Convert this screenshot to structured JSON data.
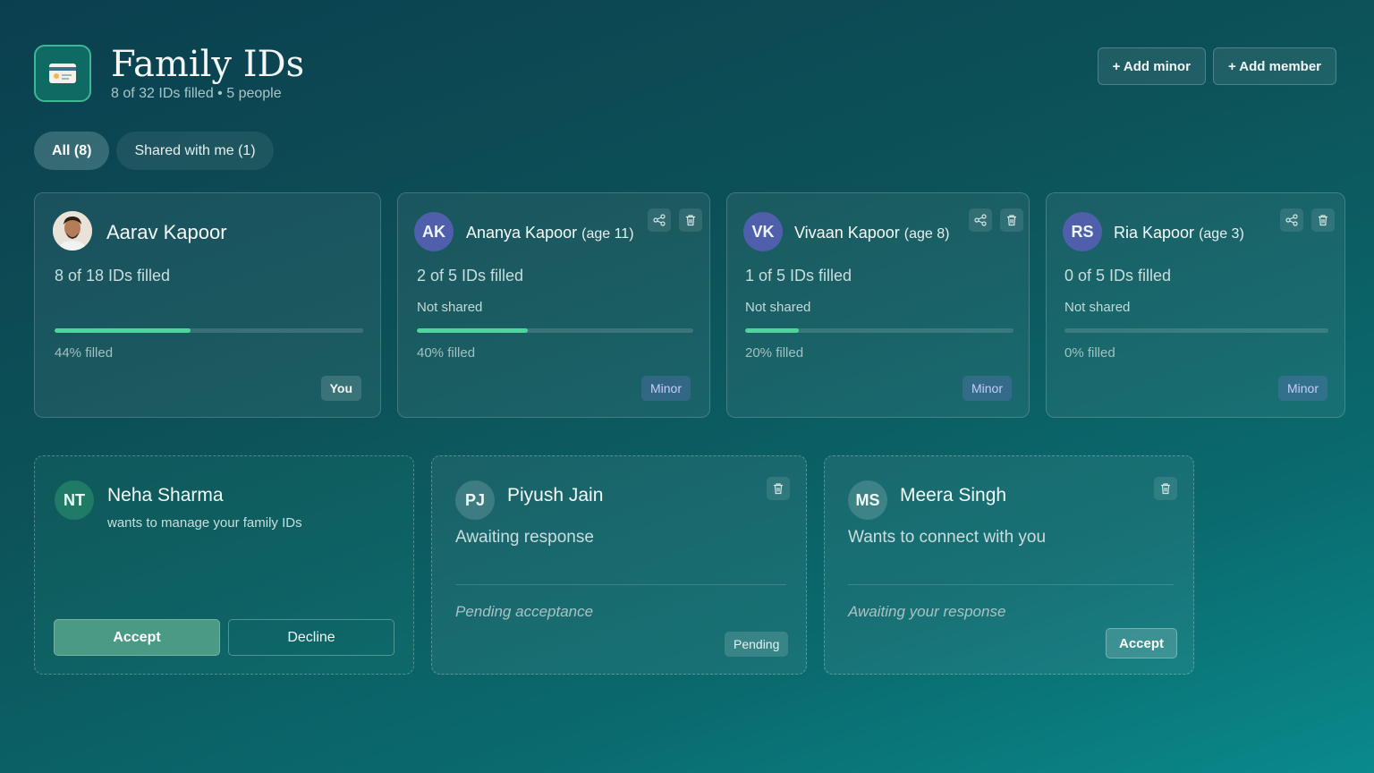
{
  "header": {
    "title": "Family IDs",
    "subtitle": "8 of 32 IDs filled • 5 people",
    "add_minor": "+ Add minor",
    "add_member": "+ Add member"
  },
  "tabs": [
    {
      "label": "All (8)",
      "active": true
    },
    {
      "label": "Shared with me (1)",
      "active": false
    }
  ],
  "members": [
    {
      "name": "Aarav Kapoor",
      "age": "",
      "ids": "8 of 18 IDs filled",
      "shared": "",
      "progress": 0.44,
      "pct_label": "44% filled",
      "badge": "You",
      "avatar": "photo"
    },
    {
      "name": "Ananya Kapoor",
      "age": "(age 11)",
      "ids": "2 of 5 IDs filled",
      "shared": "Not shared",
      "progress": 0.4,
      "pct_label": "40% filled",
      "badge": "Minor",
      "initials": "AK"
    },
    {
      "name": "Vivaan Kapoor",
      "age": "(age 8)",
      "ids": "1 of 5 IDs filled",
      "shared": "Not shared",
      "progress": 0.2,
      "pct_label": "20% filled",
      "badge": "Minor",
      "initials": "VK"
    },
    {
      "name": "Ria Kapoor",
      "age": "(age 3)",
      "ids": "0 of 5 IDs filled",
      "shared": "Not shared",
      "progress": 0.0,
      "pct_label": "0% filled",
      "badge": "Minor",
      "initials": "RS"
    }
  ],
  "requests": [
    {
      "initials": "NT",
      "name": "Neha Sharma",
      "desc": "wants to manage your family IDs",
      "accept": "Accept",
      "decline": "Decline"
    },
    {
      "initials": "PJ",
      "name": "Piyush Jain",
      "status": "Awaiting response",
      "note": "Pending acceptance",
      "badge": "Pending"
    },
    {
      "initials": "MS",
      "name": "Meera Singh",
      "status": "Wants to connect with you",
      "note": "Awaiting your response",
      "accept": "Accept"
    }
  ],
  "colors": {
    "accent": "#4fd49c",
    "minor_badge": "#c7cdfb",
    "avatar_purple": "#4f5fab"
  }
}
